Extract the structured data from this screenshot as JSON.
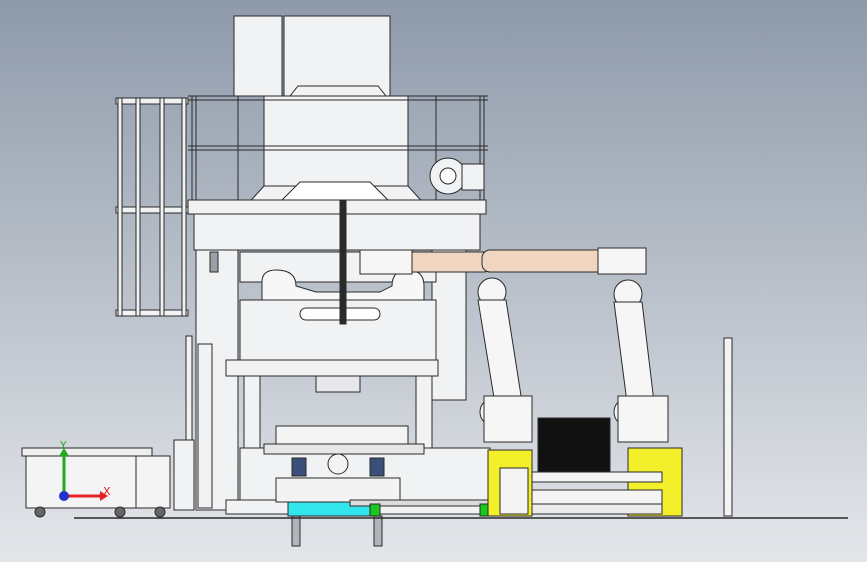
{
  "background": {
    "top": "#8e9aaa",
    "bottom": "#e4e6ea"
  },
  "colors": {
    "frame": "#f1f2f4",
    "line": "#2a2a2a",
    "robot_body": "#f6f6f6",
    "robot_joint": "#f0d6c0",
    "motor": "#3a4f7a",
    "yellow_unit": "#f3ef2a",
    "cyan_tray": "#33e6ee",
    "green_part": "#19c81e",
    "dark_panel": "#111111"
  },
  "triad": {
    "x_label": "X",
    "y_label": "Y",
    "x_color": "#e52222",
    "y_color": "#22aa22",
    "z_color": "#2233cc"
  }
}
